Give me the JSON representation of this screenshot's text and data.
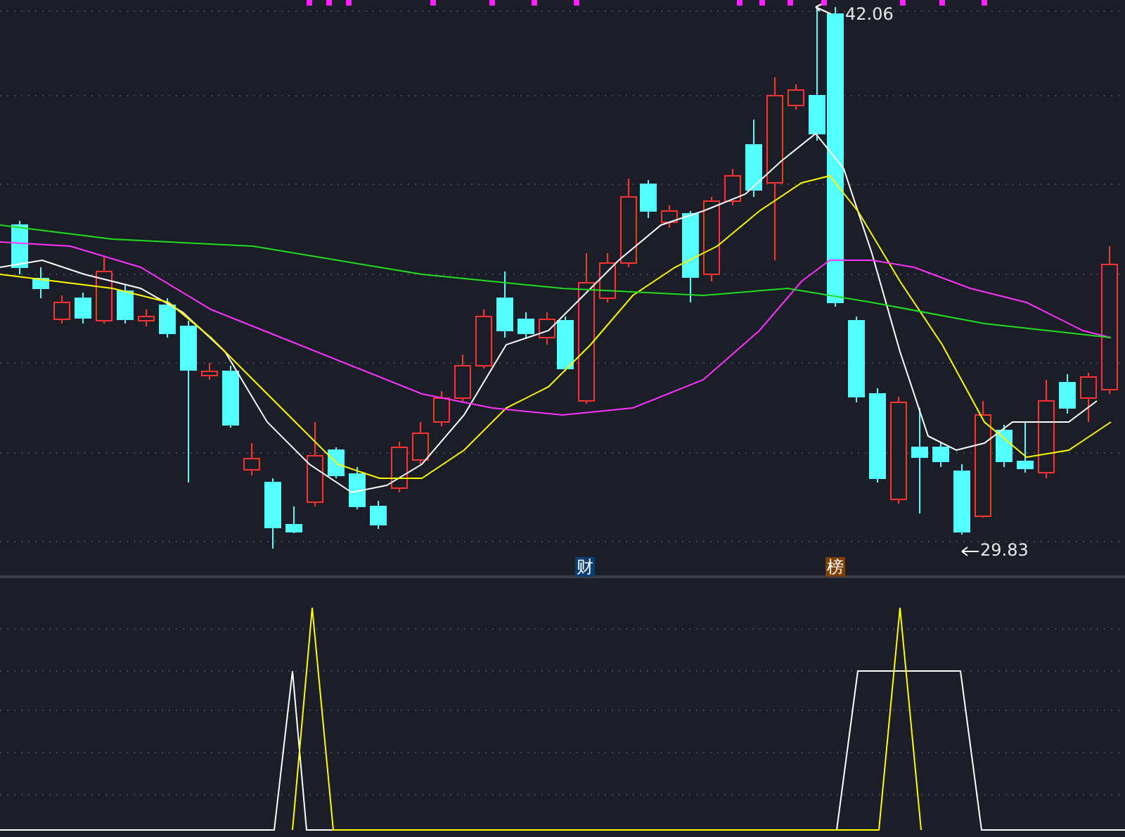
{
  "price_panel": {
    "high_label": "42.06",
    "low_label": "29.83",
    "markers": [
      {
        "text": "财",
        "color": "#0b3d6e"
      },
      {
        "text": "榜",
        "color": "#7b3f00"
      }
    ]
  }
}
